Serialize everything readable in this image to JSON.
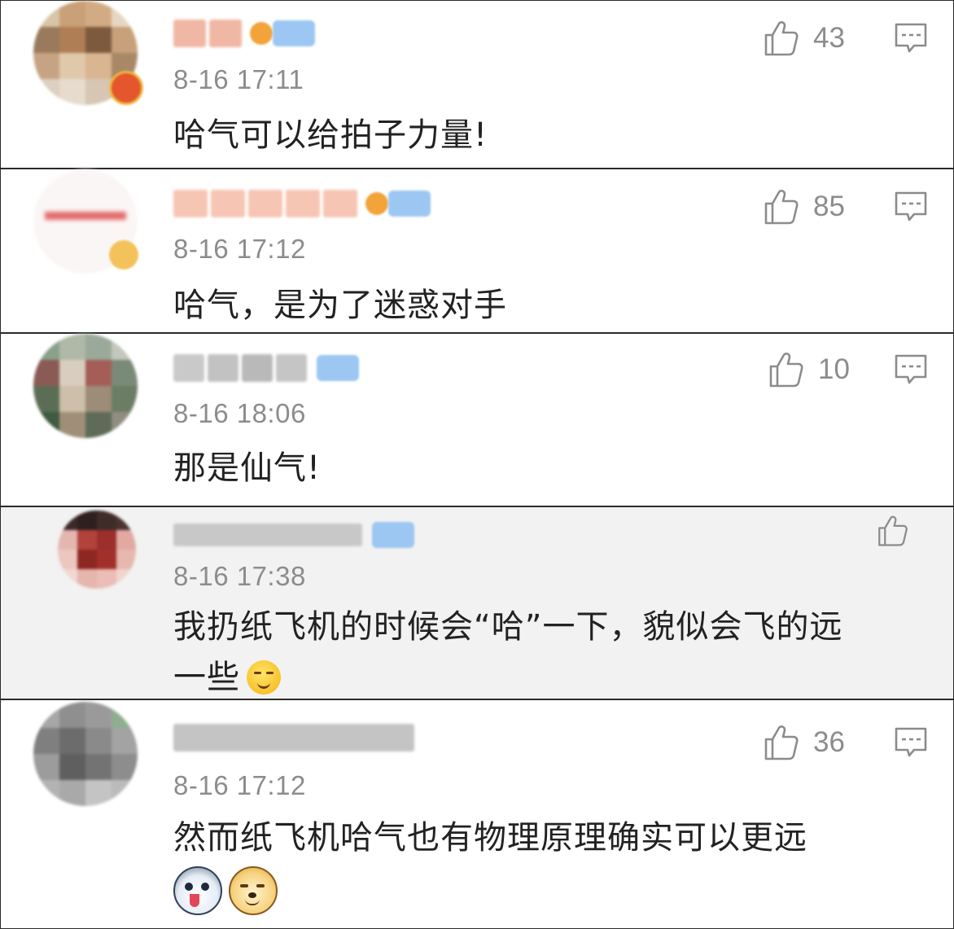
{
  "comments": [
    {
      "timestamp": "8-16 17:11",
      "text": "哈气可以给拍子力量!",
      "likes": "43",
      "user_vip": true
    },
    {
      "timestamp": "8-16 17:12",
      "text": "哈气，是为了迷惑对手",
      "likes": "85",
      "user_vip": true
    },
    {
      "timestamp": "8-16 18:06",
      "text": "那是仙气!",
      "likes": "10",
      "user_vip": true
    },
    {
      "timestamp": "8-16 17:38",
      "text_line1": "我扔纸飞机的时候会“哈”一下，貌似会飞的远",
      "text_line2": "一些",
      "emoji": "smirk-emoji",
      "is_reply": true
    },
    {
      "timestamp": "8-16 17:12",
      "text": "然而纸飞机哈气也有物理原理确实可以更远",
      "likes": "36",
      "emojis": [
        "husky-emoji",
        "doge-emoji"
      ]
    }
  ],
  "icons": {
    "like": "thumbs-up-icon",
    "reply": "comment-icon"
  },
  "colors": {
    "timestamp": "#8c8c8c",
    "like_count": "#8c8c8c",
    "text": "#222222",
    "reply_background": "#f2f2f2",
    "divider": "#2a2a2a",
    "vip_badge": "#9cc7f2"
  }
}
